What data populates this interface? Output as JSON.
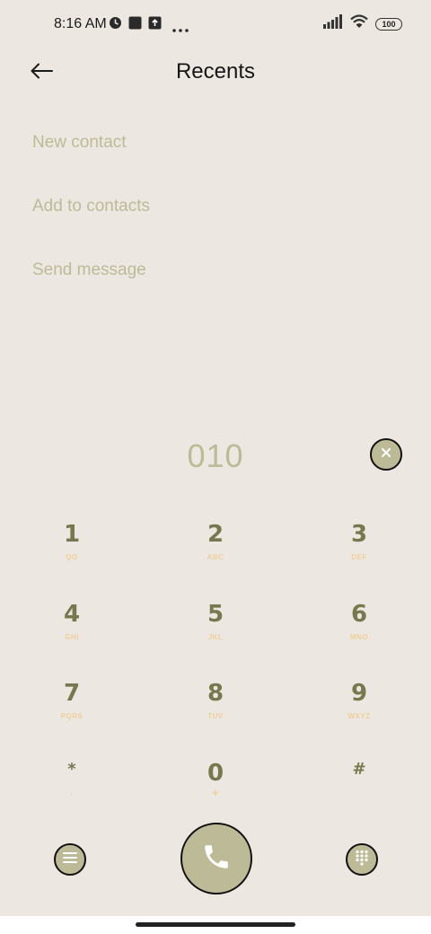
{
  "status_bar": {
    "time": "8:16 AM",
    "battery_level": "100",
    "icons": [
      "alarm-icon",
      "notification-square-icon",
      "upload-icon",
      "more-dots-icon",
      "signal-icon",
      "wifi-icon",
      "battery-icon"
    ]
  },
  "header": {
    "title": "Recents",
    "back_icon": "arrow-left-icon"
  },
  "actions": [
    {
      "label": "New contact"
    },
    {
      "label": "Add to contacts"
    },
    {
      "label": "Send message"
    }
  ],
  "dialer": {
    "number": "010",
    "clear_icon": "close-icon"
  },
  "keypad": [
    {
      "digit": "1",
      "letters": "QO"
    },
    {
      "digit": "2",
      "letters": "ABC"
    },
    {
      "digit": "3",
      "letters": "DEF"
    },
    {
      "digit": "4",
      "letters": "GHI"
    },
    {
      "digit": "5",
      "letters": "JKL"
    },
    {
      "digit": "6",
      "letters": "MNO"
    },
    {
      "digit": "7",
      "letters": "PQRS"
    },
    {
      "digit": "8",
      "letters": "TUV"
    },
    {
      "digit": "9",
      "letters": "WXYZ"
    },
    {
      "digit": "*",
      "letters": ","
    },
    {
      "digit": "0",
      "letters": "+"
    },
    {
      "digit": "#",
      "letters": ""
    }
  ],
  "colors": {
    "background": "#ede7e1",
    "accent": "#bdbb97",
    "digit": "#77784f",
    "letters": "#efcf9b"
  }
}
